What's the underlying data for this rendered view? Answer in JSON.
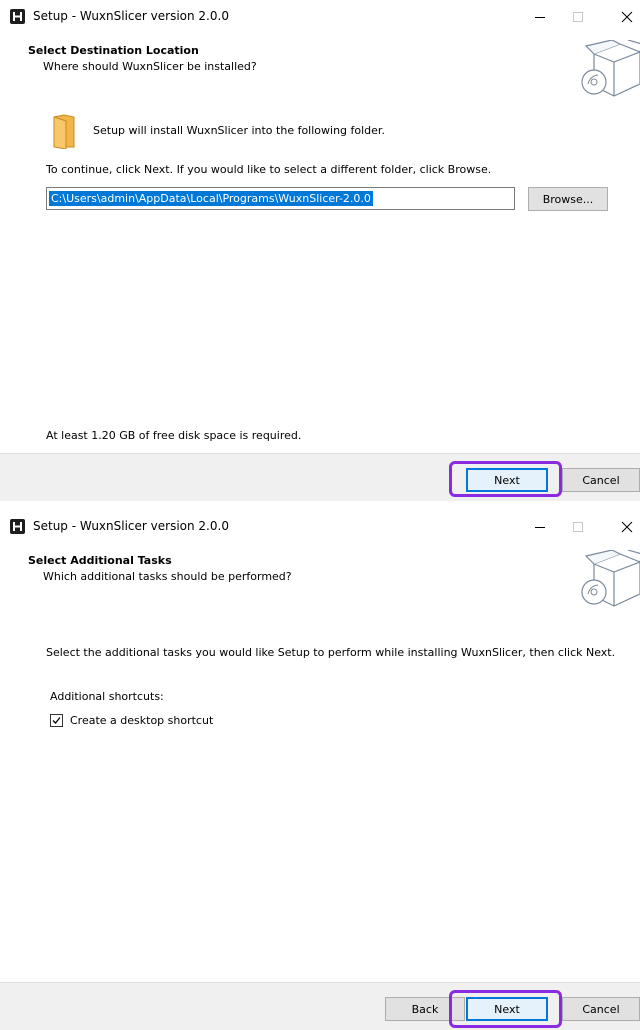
{
  "window1": {
    "title": "Setup - WuxnSlicer version 2.0.0",
    "header_title": "Select Destination Location",
    "header_subtitle": "Where should WuxnSlicer be installed?",
    "folder_message": "Setup will install WuxnSlicer into the following folder.",
    "instruction": "To continue, click Next. If you would like to select a different folder, click Browse.",
    "install_path": "C:\\Users\\admin\\AppData\\Local\\Programs\\WuxnSlicer-2.0.0",
    "browse_label": "Browse...",
    "disk_space": "At least 1.20 GB of free disk space is required.",
    "next_label": "Next",
    "cancel_label": "Cancel"
  },
  "window2": {
    "title": "Setup - WuxnSlicer version 2.0.0",
    "header_title": "Select Additional Tasks",
    "header_subtitle": "Which additional tasks should be performed?",
    "instruction": "Select the additional tasks you would like Setup to perform while installing WuxnSlicer, then click Next.",
    "group_label": "Additional shortcuts:",
    "checkbox_label": "Create a desktop shortcut",
    "checkbox_checked": true,
    "back_label": "Back",
    "next_label": "Next",
    "cancel_label": "Cancel"
  },
  "colors": {
    "highlight": "#8a2be2",
    "selection": "#0078d7",
    "footer": "#f0f0f0"
  },
  "icons": [
    "app-icon",
    "minimize-icon",
    "maximize-icon",
    "close-icon",
    "install-box-icon",
    "folder-icon",
    "checkmark-icon"
  ]
}
